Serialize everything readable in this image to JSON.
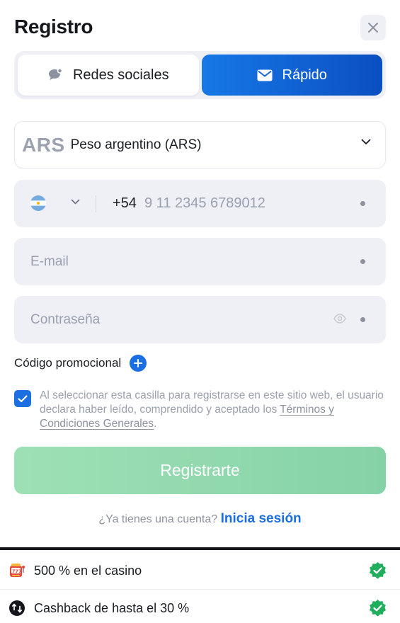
{
  "header": {
    "title": "Registro",
    "close_icon": "close-icon"
  },
  "tabs": [
    {
      "label": "Redes sociales",
      "icon": "speech-bubble-icon",
      "active": false
    },
    {
      "label": "Rápido",
      "icon": "envelope-icon",
      "active": true
    }
  ],
  "currency": {
    "code": "ARS",
    "name": "Peso argentino (ARS)"
  },
  "phone": {
    "country_flag": "argentina-flag-icon",
    "prefix": "+54",
    "placeholder": "9 11 2345 6789012"
  },
  "email": {
    "placeholder": "E-mail"
  },
  "password": {
    "placeholder": "Contraseña"
  },
  "promo": {
    "label": "Código promocional"
  },
  "consent": {
    "checked": true,
    "text": "Al seleccionar esta casilla para registrarse en este sitio web, el usuario declara haber leído, comprendido y aceptado los",
    "link": "Términos y Condiciones Generales",
    "suffix": "."
  },
  "register_button": {
    "label": "Registrarte"
  },
  "login": {
    "prompt": "¿Ya tienes una cuenta?",
    "link": "Inicia sesión"
  },
  "bonuses": [
    {
      "icon": "slot-machine-icon",
      "text": "500 % en el casino"
    },
    {
      "icon": "cashback-icon",
      "text": "Cashback de hasta el 30 %"
    }
  ],
  "colors": {
    "accent": "#1b6fe0",
    "register_green": "#8fd8ad",
    "check_green": "#1fae5b"
  }
}
